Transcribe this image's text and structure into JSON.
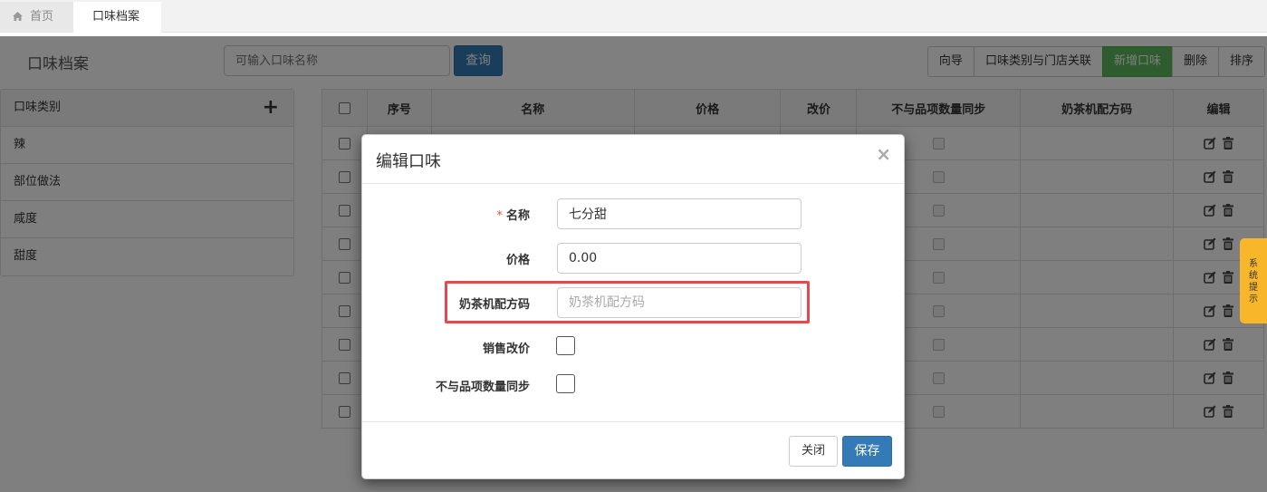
{
  "tabs": {
    "home_label": "首页",
    "active_label": "口味档案"
  },
  "page": {
    "title": "口味档案",
    "search_placeholder": "可输入口味名称",
    "query_label": "查询",
    "buttons": {
      "guide": "向导",
      "link_store": "口味类别与门店关联",
      "add": "新增口味",
      "delete": "删除",
      "sort": "排序"
    }
  },
  "categories": {
    "header": "口味类别",
    "items": [
      "辣",
      "部位做法",
      "咸度",
      "甜度"
    ]
  },
  "table": {
    "headers": [
      "序号",
      "名称",
      "价格",
      "改价",
      "不与品项数量同步",
      "奶茶机配方码",
      "编辑"
    ],
    "row_count": 9
  },
  "side_tab": {
    "label": "系统提示"
  },
  "modal": {
    "title": "编辑口味",
    "close_glyph": "×",
    "fields": {
      "name": {
        "label": "名称",
        "required_mark": "*",
        "value": "七分甜"
      },
      "price": {
        "label": "价格",
        "value": "0.00"
      },
      "recipe_code": {
        "label": "奶茶机配方码",
        "placeholder": "奶茶机配方码"
      },
      "sale_price_change": {
        "label": "销售改价",
        "checked": false
      },
      "no_sync_qty": {
        "label": "不与品项数量同步",
        "checked": false
      }
    },
    "close_button": "关闭",
    "save_button": "保存"
  },
  "colors": {
    "primary": "#337ab7",
    "success": "#5cb85c",
    "highlight": "#e8484b",
    "side_tab": "#f8b62b"
  }
}
